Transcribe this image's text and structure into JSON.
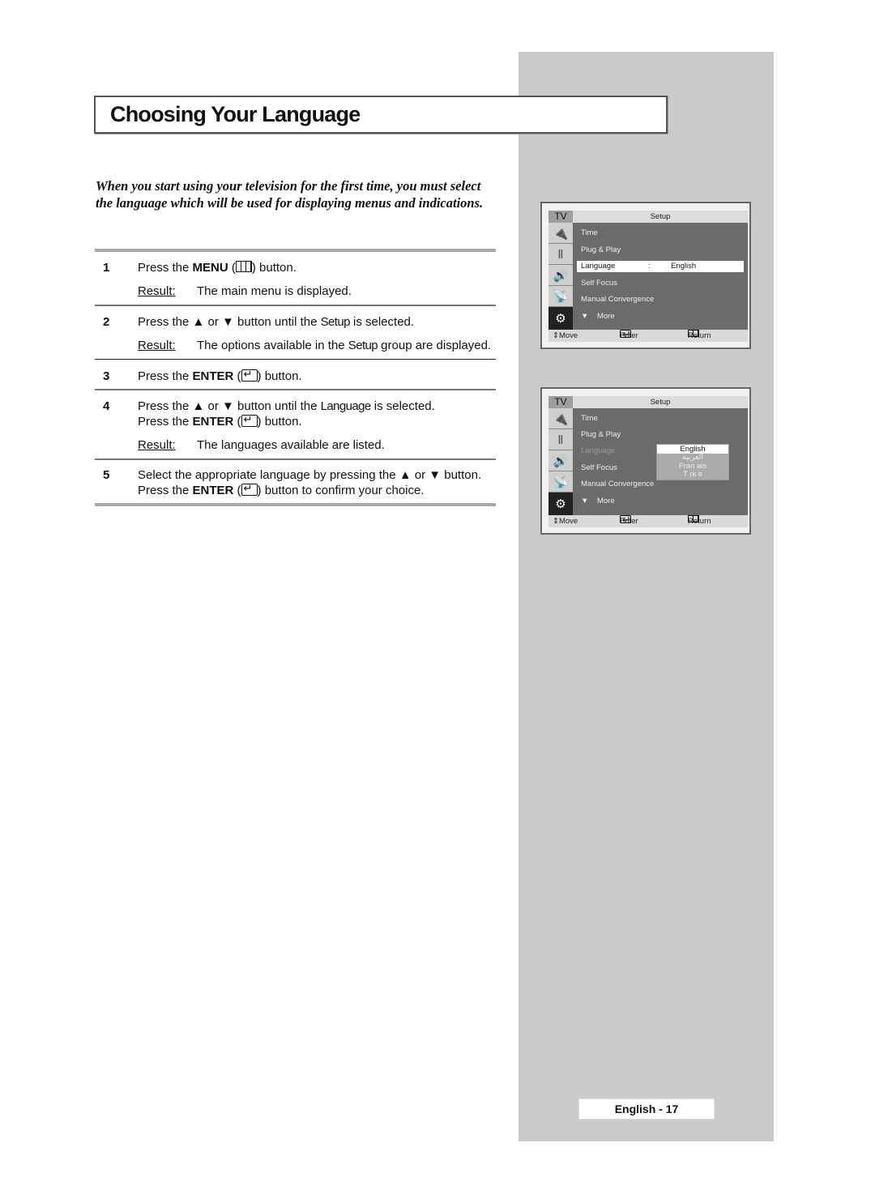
{
  "page": {
    "title": "Choosing Your Language",
    "intro": "When you start using your television for the first time, you must select the language which will be used for displaying menus and indications.",
    "page_number": "English - 17"
  },
  "steps": [
    {
      "num": "1",
      "pre": "Press the ",
      "key": "MENU",
      "glyph": "menu-icon",
      "post": " button.",
      "result_label": "Result:",
      "result": "The main menu is displayed."
    },
    {
      "num": "2",
      "pre": "Press the ▲ or ▼ button until the ",
      "kw": "Setup",
      "post": "  is selected.",
      "result_label": "Result:",
      "result_pre": "The options available in the ",
      "result_kw": "Setup",
      "result_post": "  group are displayed."
    },
    {
      "num": "3",
      "pre": "Press the ",
      "key": "ENTER",
      "glyph": "enter-icon",
      "post": " button."
    },
    {
      "num": "4",
      "pre": "Press the ▲ or ▼ button until the ",
      "kw": "Language",
      "post": "  is selected.",
      "line2_pre": "Press the ",
      "line2_key": "ENTER",
      "line2_post": " button.",
      "result_label": "Result:",
      "result": "The languages available are listed."
    },
    {
      "num": "5",
      "pre": "Select the appropriate language by pressing the ▲ or ▼ button.",
      "line2_pre": "Press the ",
      "line2_key": "ENTER",
      "line2_post": " button to confirm your choice."
    }
  ],
  "screens": [
    {
      "label": "TV",
      "title": "Setup",
      "items": [
        "Time",
        "Plug & Play",
        "Language",
        "Self Focus",
        "Manual Convergence",
        "More"
      ],
      "selected_item": "Language",
      "language_colon": ":",
      "language_value": "English",
      "footer": {
        "move": "Move",
        "enter": "Enter",
        "return": "Return"
      }
    },
    {
      "label": "TV",
      "title": "Setup",
      "items": [
        "Time",
        "Plug & Play",
        "Language",
        "Self Focus",
        "Manual Convergence",
        "More"
      ],
      "language_colon": ": E",
      "dropdown": [
        "English",
        "العربية",
        "Fran ais",
        "T rk e"
      ],
      "dropdown_selected": "English",
      "footer": {
        "move": "Move",
        "enter": "Enter",
        "return": "Return"
      }
    }
  ],
  "icons": {
    "sidebar": [
      "input-icon",
      "picture-icon",
      "sound-icon",
      "channel-icon",
      "setup-icon"
    ],
    "move": "⇕",
    "more": "▼"
  }
}
